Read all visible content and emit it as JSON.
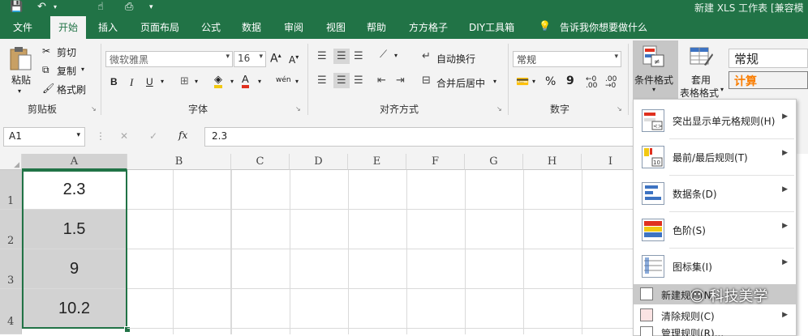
{
  "title_bar": {
    "title": "新建 XLS 工作表 [兼容模"
  },
  "tabs": [
    "文件",
    "开始",
    "插入",
    "页面布局",
    "公式",
    "数据",
    "审阅",
    "视图",
    "帮助",
    "方方格子",
    "DIY工具箱"
  ],
  "tell_me": "告诉我你想要做什么",
  "clipboard": {
    "paste": "粘贴",
    "cut": "剪切",
    "copy": "复制",
    "format_painter": "格式刷",
    "group": "剪贴板"
  },
  "font": {
    "name": "微软雅黑",
    "size": "16",
    "bold": "B",
    "italic": "I",
    "underline": "U",
    "group": "字体",
    "grow": "A",
    "shrink": "A",
    "phonetic": "wén"
  },
  "alignment": {
    "wrap": "自动换行",
    "merge": "合并后居中",
    "group": "对齐方式"
  },
  "number": {
    "format": "常规",
    "percent": "%",
    "comma": "9",
    "group": "数字"
  },
  "styles": {
    "cond_format": "条件格式",
    "table_format_1": "套用",
    "table_format_2": "表格格式",
    "style_normal": "常规",
    "style_calc": "计算"
  },
  "formula_bar": {
    "name_box": "A1",
    "value": "2.3",
    "fx": "fx"
  },
  "columns": [
    "A",
    "B",
    "C",
    "D",
    "E",
    "F",
    "G",
    "H",
    "I"
  ],
  "rows": [
    "1",
    "2",
    "3",
    "4"
  ],
  "cells_A": [
    "2.3",
    "1.5",
    "9",
    "10.2"
  ],
  "cond_menu": [
    {
      "label": "突出显示单元格规则(H)",
      "icon": "highlight-rules-icon",
      "arrow": true
    },
    {
      "label": "最前/最后规则(T)",
      "icon": "top-bottom-rules-icon",
      "arrow": true
    },
    {
      "label": "数据条(D)",
      "icon": "data-bars-icon",
      "arrow": true
    },
    {
      "label": "色阶(S)",
      "icon": "color-scales-icon",
      "arrow": true
    },
    {
      "label": "图标集(I)",
      "icon": "icon-sets-icon",
      "arrow": true
    },
    {
      "label": "新建规则(N)...",
      "icon": "new-rule-icon",
      "arrow": false
    },
    {
      "label": "清除规则(C)",
      "icon": "clear-rules-icon",
      "arrow": true
    },
    {
      "label": "管理规则(R)...",
      "icon": "manage-rules-icon",
      "arrow": false
    }
  ],
  "watermark": "科技美学",
  "colors": {
    "excel_green": "#217346",
    "selected_fill": "#d2d2d2",
    "menu_highlight": "#c9c9c9",
    "accent_red": "#e0301e",
    "accent_yellow": "#f2c811"
  }
}
